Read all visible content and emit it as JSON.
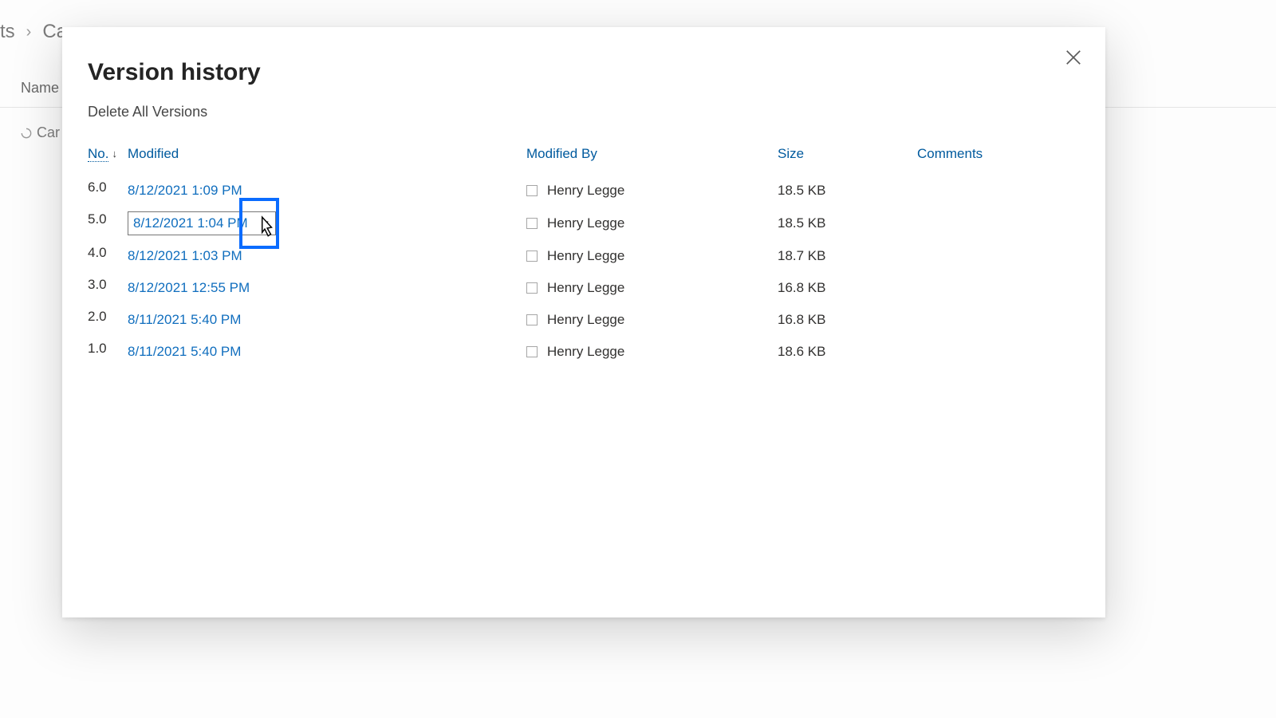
{
  "backdrop": {
    "breadcrumb_prev_fragment": "ts",
    "breadcrumb_current_fragment": "Ca",
    "column_header_name": "Name",
    "file_item_fragment": "Car typ"
  },
  "modal": {
    "title": "Version history",
    "delete_all_label": "Delete All Versions",
    "close_aria": "Close"
  },
  "columns": {
    "no": "No.",
    "modified": "Modified",
    "modified_by": "Modified By",
    "size": "Size",
    "comments": "Comments"
  },
  "versions": [
    {
      "no": "6.0",
      "modified": "8/12/2021 1:09 PM",
      "modified_by": "Henry Legge",
      "size": "18.5 KB",
      "comment": "",
      "selected": false
    },
    {
      "no": "5.0",
      "modified": "8/12/2021 1:04 PM",
      "modified_by": "Henry Legge",
      "size": "18.5 KB",
      "comment": "",
      "selected": true
    },
    {
      "no": "4.0",
      "modified": "8/12/2021 1:03 PM",
      "modified_by": "Henry Legge",
      "size": "18.7 KB",
      "comment": "",
      "selected": false
    },
    {
      "no": "3.0",
      "modified": "8/12/2021 12:55 PM",
      "modified_by": "Henry Legge",
      "size": "16.8 KB",
      "comment": "",
      "selected": false
    },
    {
      "no": "2.0",
      "modified": "8/11/2021 5:40 PM",
      "modified_by": "Henry Legge",
      "size": "16.8 KB",
      "comment": "",
      "selected": false
    },
    {
      "no": "1.0",
      "modified": "8/11/2021 5:40 PM",
      "modified_by": "Henry Legge",
      "size": "18.6 KB",
      "comment": "",
      "selected": false
    }
  ]
}
